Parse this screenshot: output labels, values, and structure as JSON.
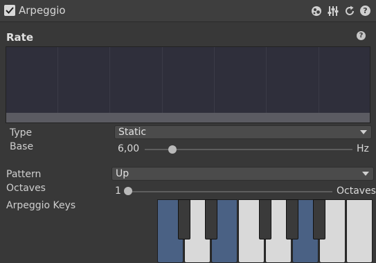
{
  "header": {
    "enabled": true,
    "title": "Arpeggio",
    "icons": [
      "preset-icon",
      "mixer-icon",
      "reset-icon",
      "help-icon"
    ]
  },
  "rate": {
    "label": "Rate",
    "help_glyph": "?"
  },
  "fields": {
    "type_label": "Type",
    "type_value": "Static",
    "base_label": "Base",
    "base_value": "6,00",
    "base_unit": "Hz",
    "pattern_label": "Pattern",
    "pattern_value": "Up",
    "octaves_label": "Octaves",
    "octaves_value": "1",
    "octaves_unit": "Octaves"
  },
  "keys": {
    "label": "Arpeggio Keys",
    "white_keys_on": [
      true,
      false,
      true,
      false,
      false,
      true,
      false,
      false
    ],
    "black_keys_on": [
      false,
      false,
      false,
      false,
      false
    ]
  },
  "colors": {
    "key_on": "#4a6184",
    "key_off": "#d9d9d9"
  }
}
